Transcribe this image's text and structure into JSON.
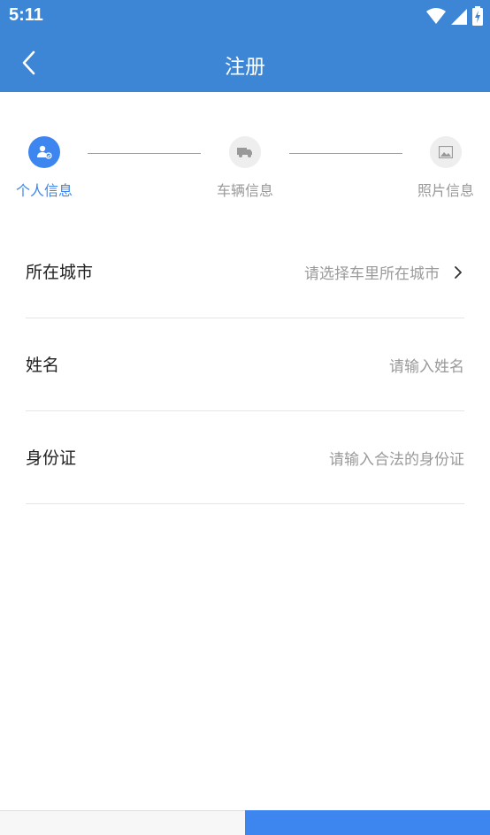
{
  "status_bar": {
    "time": "5:11",
    "icons": [
      "wifi-icon",
      "signal-icon",
      "battery-charging-icon"
    ]
  },
  "app_bar": {
    "back_icon": "back-arrow-icon",
    "title": "注册"
  },
  "stepper": {
    "steps": [
      {
        "label": "个人信息",
        "icon": "person-icon",
        "state": "active"
      },
      {
        "label": "车辆信息",
        "icon": "truck-icon",
        "state": "inactive"
      },
      {
        "label": "照片信息",
        "icon": "image-icon",
        "state": "inactive"
      }
    ]
  },
  "form": {
    "rows": [
      {
        "label": "所在城市",
        "value": "请选择车里所在城市",
        "has_chevron": true
      },
      {
        "label": "姓名",
        "value": "请输入姓名",
        "has_chevron": false
      },
      {
        "label": "身份证",
        "value": "请输入合法的身份证",
        "has_chevron": false
      }
    ]
  },
  "colors": {
    "primary": "#3d86d6",
    "accent": "#3d86f0",
    "placeholder": "#9a9a9a",
    "inactive": "#999999"
  }
}
